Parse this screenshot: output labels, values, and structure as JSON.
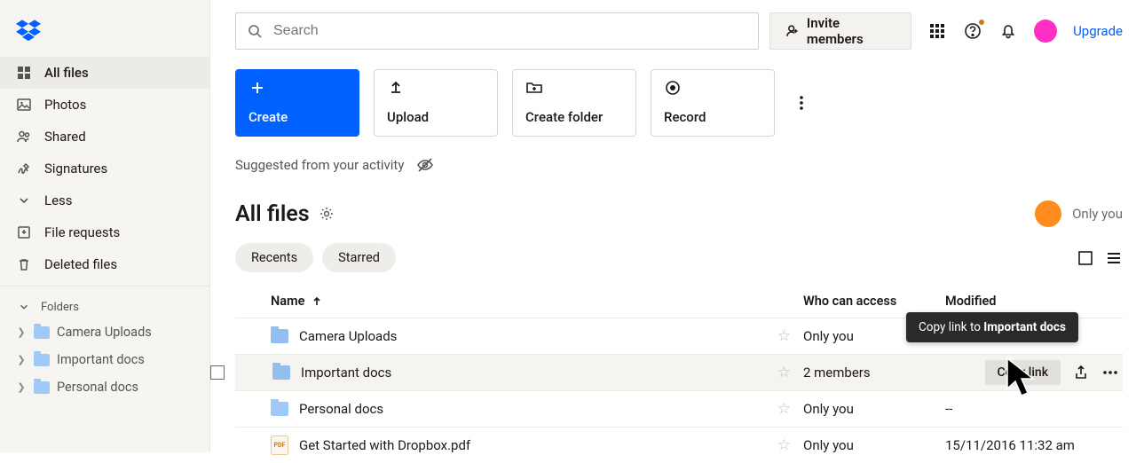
{
  "sidebar": {
    "items": [
      {
        "label": "All files"
      },
      {
        "label": "Photos"
      },
      {
        "label": "Shared"
      },
      {
        "label": "Signatures"
      },
      {
        "label": "Less"
      },
      {
        "label": "File requests"
      },
      {
        "label": "Deleted files"
      }
    ],
    "folders_label": "Folders",
    "tree": [
      {
        "label": "Camera Uploads"
      },
      {
        "label": "Important docs"
      },
      {
        "label": "Personal docs"
      }
    ]
  },
  "search": {
    "placeholder": "Search"
  },
  "invite_label": "Invite members",
  "upgrade_label": "Upgrade",
  "cards": {
    "create": "Create",
    "upload": "Upload",
    "create_folder": "Create folder",
    "record": "Record"
  },
  "suggested_label": "Suggested from your activity",
  "page_title": "All files",
  "visibility_label": "Only you",
  "pills": {
    "recents": "Recents",
    "starred": "Starred"
  },
  "columns": {
    "name": "Name",
    "access": "Who can access",
    "modified": "Modified"
  },
  "rows": [
    {
      "name": "Camera Uploads",
      "access": "Only you",
      "modified": "",
      "type": "folder"
    },
    {
      "name": "Important docs",
      "access": "2 members",
      "modified": "",
      "type": "folder-shared"
    },
    {
      "name": "Personal docs",
      "access": "Only you",
      "modified": "--",
      "type": "folder"
    },
    {
      "name": "Get Started with Dropbox.pdf",
      "access": "Only you",
      "modified": "15/11/2016 11:32 am",
      "type": "pdf"
    }
  ],
  "copy_link_label": "Copy link",
  "tooltip": {
    "prefix": "Copy link to ",
    "target": "Important docs"
  }
}
